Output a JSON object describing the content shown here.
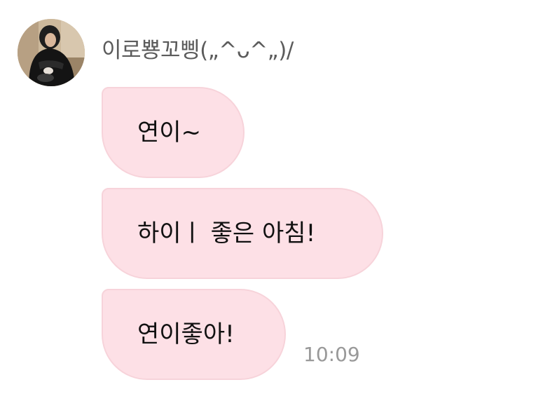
{
  "chat": {
    "sender": {
      "name": "이로뿅꼬삥(„^ᴗ^„)/",
      "avatar_icon": "profile-photo"
    },
    "messages": [
      {
        "text": "연이~"
      },
      {
        "text": "하이ㅣ  좋은 아침!"
      },
      {
        "text": "연이좋아!"
      }
    ],
    "timestamp": "10:09",
    "colors": {
      "bubble_background": "#fde0e6",
      "bubble_border": "#f7d3da",
      "name_text": "#5b5b5b",
      "timestamp_text": "#999999"
    }
  }
}
